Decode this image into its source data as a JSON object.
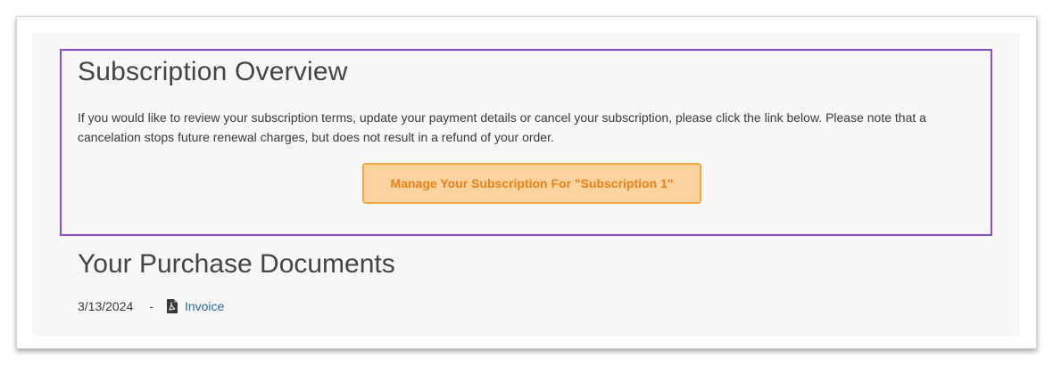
{
  "subscription": {
    "title": "Subscription Overview",
    "description": "If you would like to review your subscription terms, update your payment details or cancel your subscription, please click the link below. Please note that a cancelation stops future renewal charges, but does not result in a refund of your order.",
    "button_label": "Manage Your Subscription For \"Subscription 1\""
  },
  "documents": {
    "title": "Your Purchase Documents",
    "items": [
      {
        "date": "3/13/2024",
        "separator": "-",
        "icon": "pdf-file-icon",
        "link_label": "Invoice"
      }
    ]
  },
  "colors": {
    "box_border": "#8a4fd0",
    "button_bg": "#fbd39f",
    "button_border": "#f4a441",
    "button_text": "#e8821a",
    "link": "#2a6a9e"
  }
}
